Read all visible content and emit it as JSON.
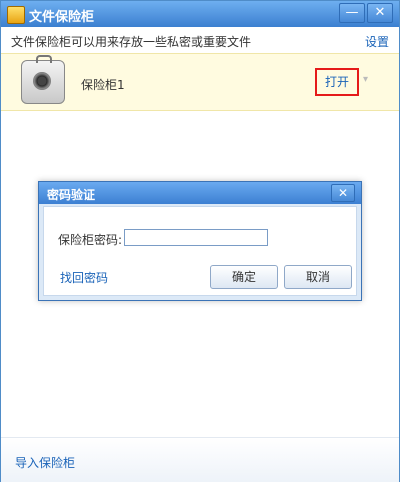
{
  "window": {
    "title": "文件保险柜",
    "minimize_label": "—",
    "close_label": "✕"
  },
  "header": {
    "description": "文件保险柜可以用来存放一些私密或重要文件",
    "settings_label": "设置"
  },
  "vault": {
    "name": "保险柜1",
    "open_label": "打开",
    "dropdown_label": "▾",
    "icon": "safe-icon"
  },
  "footer": {
    "import_label": "导入保险柜"
  },
  "dialog": {
    "title": "密码验证",
    "close_label": "✕",
    "password_label": "保险柜密码:",
    "password_value": "",
    "forgot_label": "找回密码",
    "ok_label": "确定",
    "cancel_label": "取消"
  },
  "colors": {
    "titlebar": "#3b7fd0",
    "link": "#1a63b8",
    "highlight_border": "#e51a1a",
    "vault_row_bg": "#fffbe0"
  }
}
